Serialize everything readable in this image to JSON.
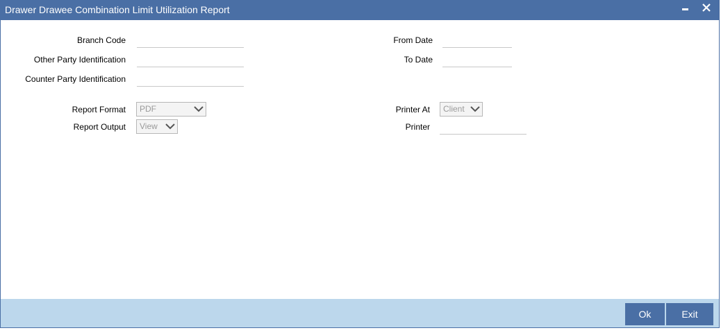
{
  "window": {
    "title": "Drawer Drawee Combination Limit Utilization Report",
    "minimize_glyph": "▁",
    "close_glyph": "✕"
  },
  "form": {
    "branch_code_label": "Branch Code",
    "other_party_label": "Other Party Identification",
    "counter_party_label": "Counter Party Identification",
    "from_date_label": "From Date",
    "to_date_label": "To Date",
    "report_format_label": "Report Format",
    "report_format_value": "PDF",
    "report_output_label": "Report Output",
    "report_output_value": "View",
    "printer_at_label": "Printer At",
    "printer_at_value": "Client",
    "printer_label": "Printer"
  },
  "footer": {
    "ok_label": "Ok",
    "exit_label": "Exit"
  },
  "colors": {
    "titlebar": "#4a6fa5",
    "footer": "#bcd7ec",
    "button": "#4a6fa5"
  }
}
